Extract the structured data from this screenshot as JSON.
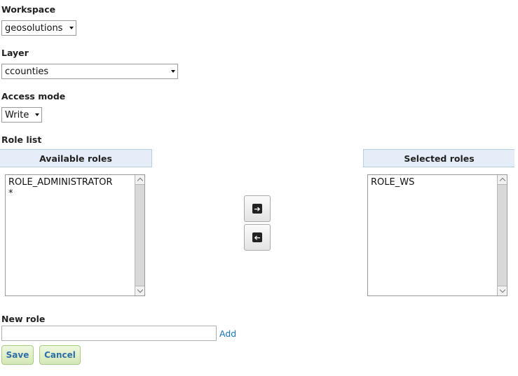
{
  "form": {
    "workspace": {
      "label": "Workspace",
      "value": "geosolutions"
    },
    "layer": {
      "label": "Layer",
      "value": "ccounties"
    },
    "access_mode": {
      "label": "Access mode",
      "value": "Write"
    },
    "role_list": {
      "label": "Role list",
      "available": {
        "header": "Available roles",
        "items": [
          "ROLE_ADMINISTRATOR",
          "*"
        ]
      },
      "selected": {
        "header": "Selected roles",
        "items": [
          "ROLE_WS"
        ]
      },
      "move_right_icon": "arrow-right-icon",
      "move_left_icon": "arrow-left-icon"
    },
    "new_role": {
      "label": "New role",
      "value": "",
      "add_label": "Add"
    },
    "buttons": {
      "save": "Save",
      "cancel": "Cancel"
    }
  },
  "colors": {
    "header_bg": "#e5eef8",
    "link": "#1a73b5",
    "button_bg": "#d3e8b6"
  }
}
